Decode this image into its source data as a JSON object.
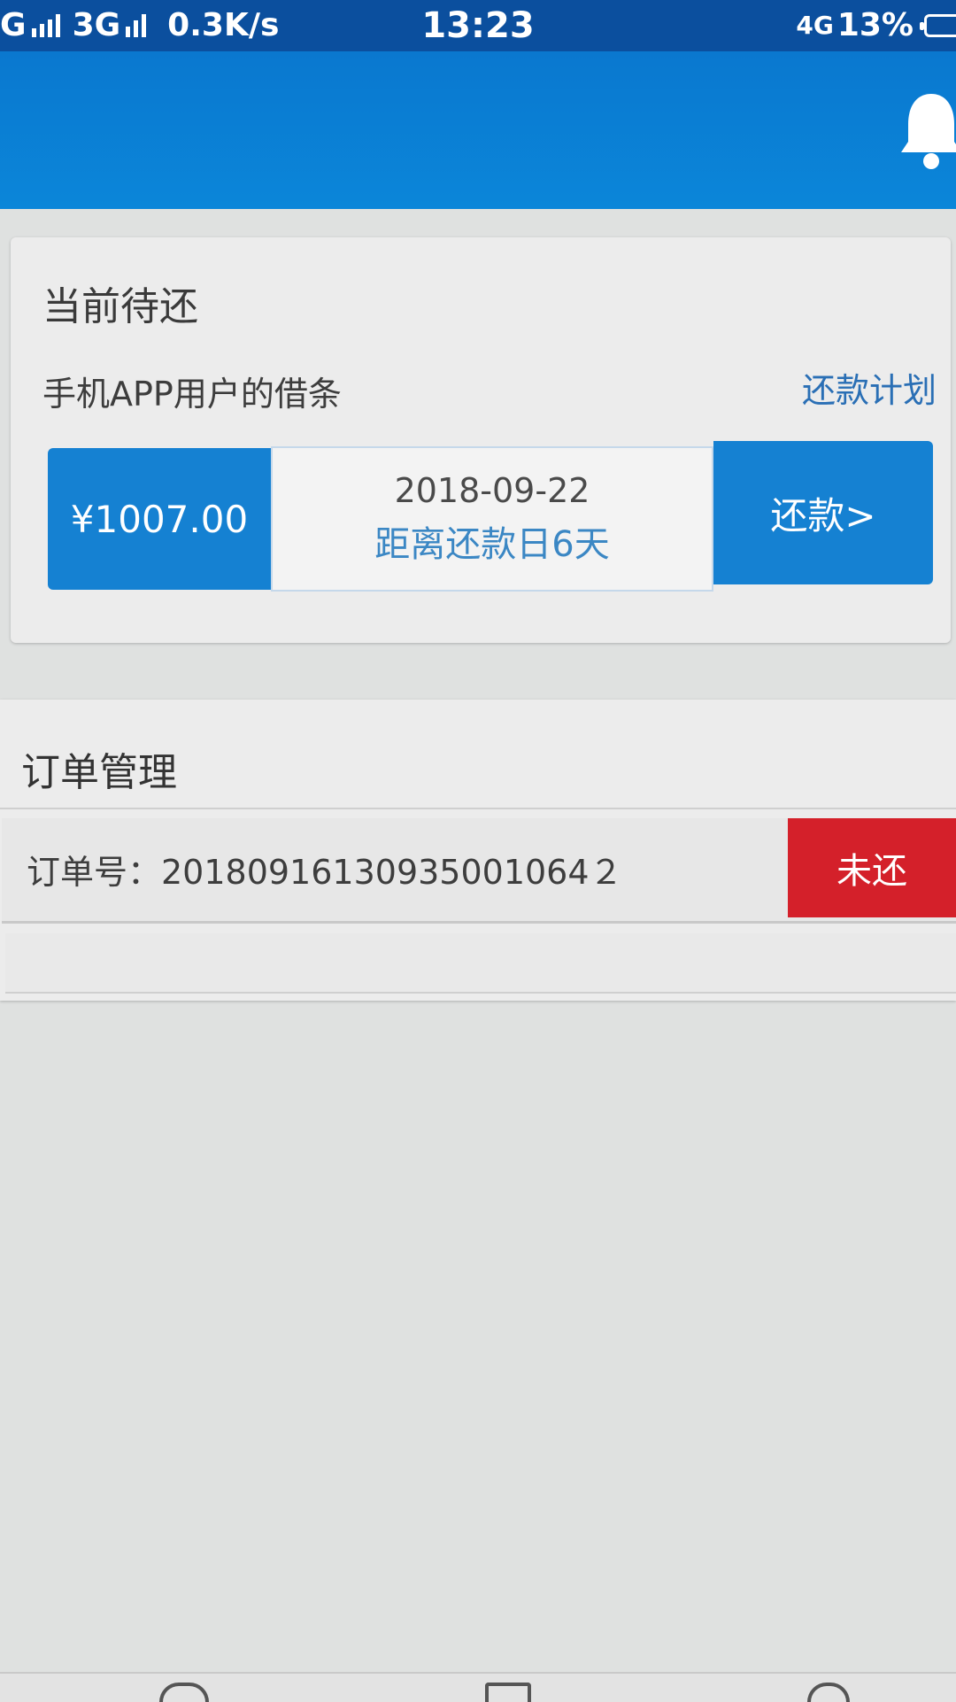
{
  "status_bar": {
    "network_1": "G",
    "network_2": "3G",
    "speed": "0.3K/s",
    "time": "13:23",
    "network_right": "4G",
    "battery": "13%"
  },
  "header": {
    "bell_icon": "bell-icon"
  },
  "current_payable": {
    "title": "当前待还",
    "loan_name": "手机APP用户的借条",
    "plan_link": "还款计划",
    "amount": "¥1007.00",
    "due_date": "2018-09-22",
    "days_left": "距离还款日6天",
    "repay_button": "还款>"
  },
  "orders": {
    "title": "订单管理",
    "items": [
      {
        "order_no": "订单号：20180916130935001064２",
        "status": "未还"
      }
    ]
  },
  "colors": {
    "header_blue": "#0b86d9",
    "button_blue": "#1581d2",
    "status_red": "#d4202a",
    "link_blue": "#2a6fb5"
  }
}
